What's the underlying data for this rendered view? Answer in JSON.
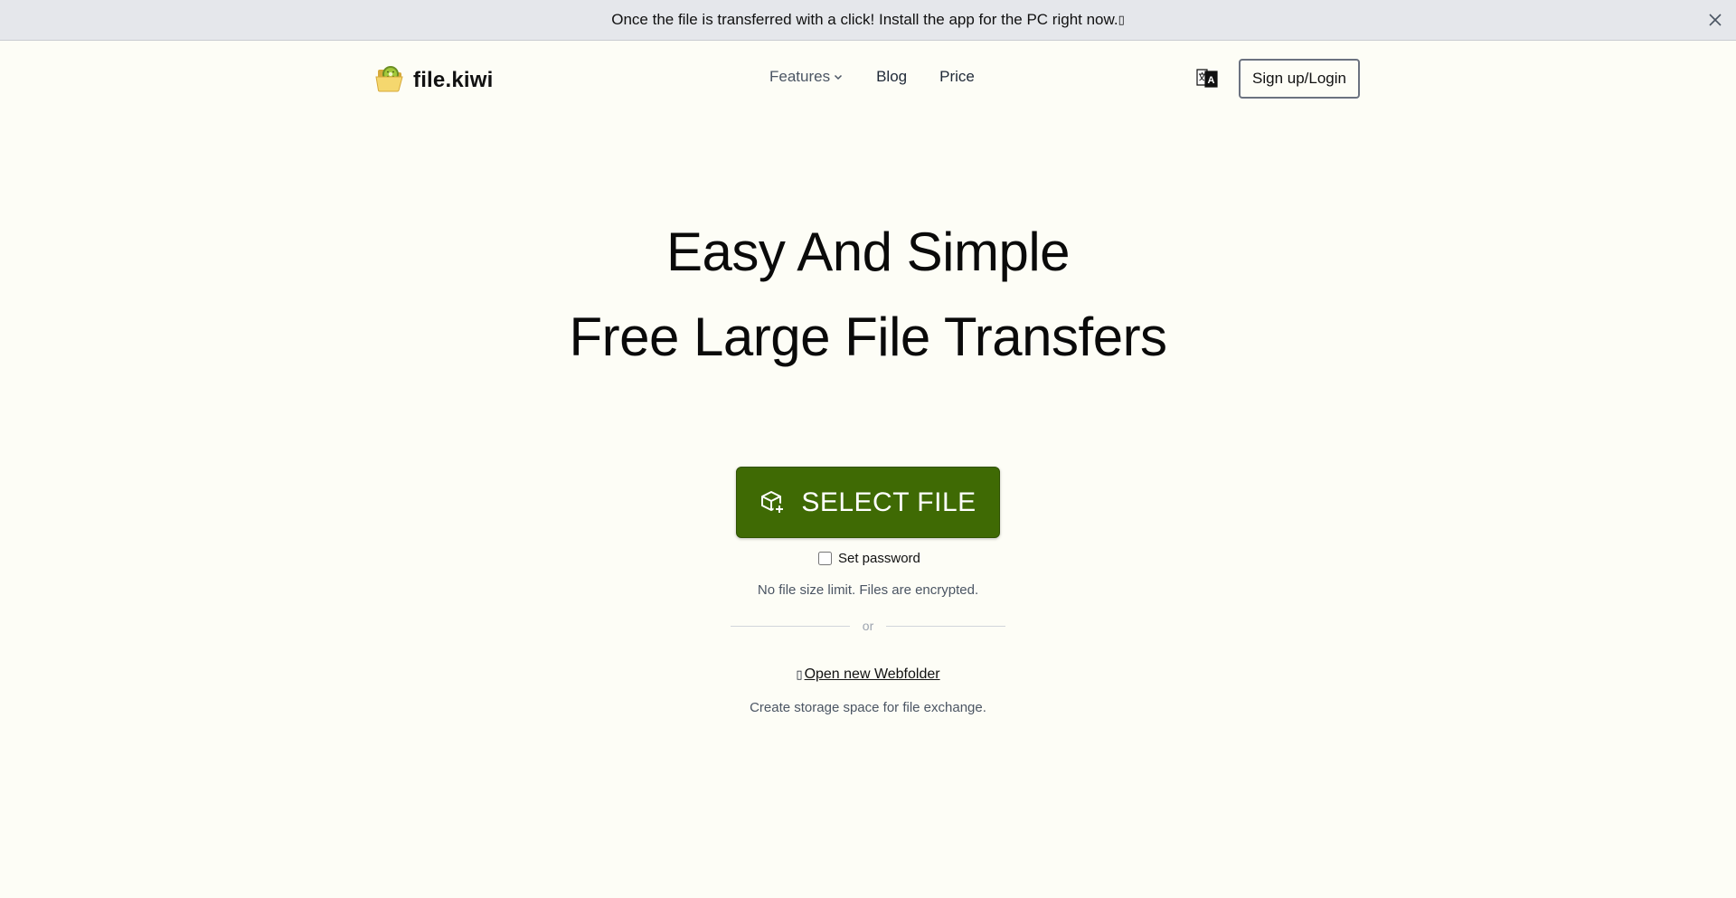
{
  "banner": {
    "text": "Once the file is transferred with a click! Install the app for the PC right now.",
    "trailing_glyph": "▯",
    "close_icon": "close-icon"
  },
  "header": {
    "logo_text": "file.kiwi",
    "logo_icon": "kiwi-folder-icon",
    "nav": {
      "features": "Features",
      "blog": "Blog",
      "price": "Price"
    },
    "language_icon": "translate-icon",
    "signup_label": "Sign up/Login"
  },
  "hero": {
    "title_line1": "Easy And Simple",
    "title_line2": "Free Large File Transfers"
  },
  "upload": {
    "select_label": "SELECT FILE",
    "select_icon": "box-plus-icon",
    "password_label": "Set password",
    "password_checked": false,
    "limit_text": "No file size limit. Files are encrypted.",
    "divider_text": "or",
    "webfolder_glyph": "▯",
    "webfolder_link": "Open new Webfolder",
    "webfolder_desc": "Create storage space for file exchange."
  },
  "colors": {
    "background": "#fdfdf6",
    "banner_bg": "#e5e7eb",
    "primary_green": "#3f6a04"
  }
}
